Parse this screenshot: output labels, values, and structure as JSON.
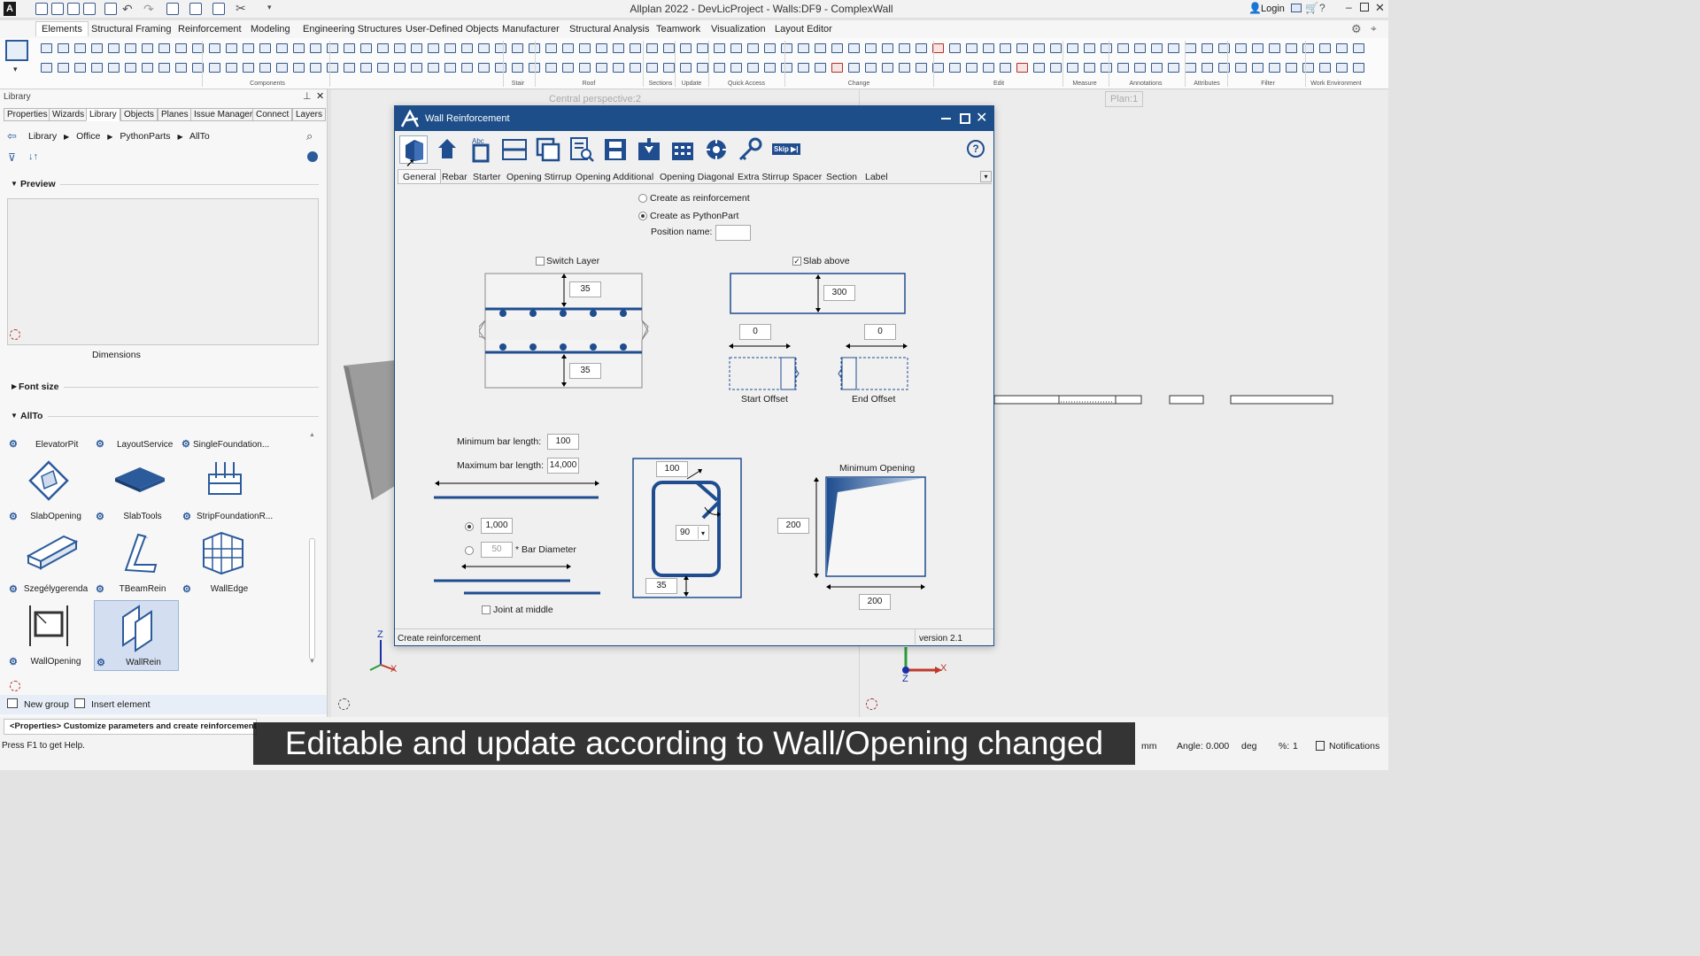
{
  "window": {
    "title": "Allplan 2022 - DevLicProject - Walls:DF9 - ComplexWall",
    "login_label": "Login"
  },
  "ribbon": {
    "tabs": [
      "Elements",
      "Structural Framing",
      "Reinforcement",
      "Modeling",
      "Engineering Structures",
      "User-Defined Objects",
      "Manufacturer",
      "Structural Analysis",
      "Teamwork",
      "Visualization",
      "Layout Editor"
    ],
    "active_tab": "Elements",
    "groups": [
      "Components",
      "Stair",
      "Roof",
      "Sections",
      "Update",
      "Quick Access",
      "Change",
      "Edit",
      "Measure",
      "Annotations",
      "Attributes",
      "Filter",
      "Work Environment"
    ]
  },
  "library": {
    "title": "Library",
    "tabs": [
      "Properties",
      "Wizards",
      "Library",
      "Objects",
      "Planes",
      "Issue Manager",
      "Connect",
      "Layers"
    ],
    "active_tab": "Library",
    "breadcrumb": [
      "Library",
      "Office",
      "PythonParts",
      "AllTo"
    ],
    "preview_label": "Preview",
    "dimensions_label": "Dimensions",
    "font_size_label": "Font size",
    "group_label": "AllTo",
    "items_row1": [
      "ElevatorPit",
      "LayoutService",
      "SingleFoundation..."
    ],
    "items": [
      {
        "label": "SlabOpening",
        "icon": "slab-opening-icon"
      },
      {
        "label": "SlabTools",
        "icon": "slab-tools-icon"
      },
      {
        "label": "StripFoundationR...",
        "icon": "strip-foundation-icon"
      },
      {
        "label": "Szegélygerenda",
        "icon": "edge-beam-icon"
      },
      {
        "label": "TBeamRein",
        "icon": "tbeam-icon"
      },
      {
        "label": "WallEdge",
        "icon": "wall-edge-icon"
      },
      {
        "label": "WallOpening",
        "icon": "wall-opening-icon"
      },
      {
        "label": "WallRein",
        "icon": "wall-rein-icon"
      }
    ],
    "selected_item": "WallRein",
    "new_group_label": "New group",
    "insert_element_label": "Insert element",
    "properties_hint": "<Properties> Customize parameters and create reinforcement"
  },
  "viewport": {
    "left_view_label": "Central perspective:2",
    "right_view_label": "Plan:1",
    "axis_z": "Z",
    "axis_x": "X"
  },
  "dialog": {
    "title": "Wall Reinforcement",
    "skip_label": "Skip",
    "tabs": [
      "General",
      "Rebar",
      "Starter",
      "Opening Stirrup",
      "Opening Additional",
      "Opening Diagonal",
      "Extra Stirrup",
      "Spacer",
      "Section",
      "Label"
    ],
    "active_tab": "General",
    "create_as_reinforcement": "Create as reinforcement",
    "create_as_pythonpart": "Create as PythonPart",
    "position_name_label": "Position name:",
    "position_name_value": "",
    "switch_layer_label": "Switch Layer",
    "switch_layer_checked": false,
    "top_cover": "35",
    "bottom_cover": "35",
    "slab_above_label": "Slab above",
    "slab_above_checked": true,
    "slab_above_value": "300",
    "start_offset_value": "0",
    "end_offset_value": "0",
    "start_offset_label": "Start Offset",
    "end_offset_label": "End Offset",
    "min_bar_length_label": "Minimum bar length:",
    "min_bar_length_value": "100",
    "max_bar_length_label": "Maximum bar length:",
    "max_bar_length_value": "14,000",
    "overlap_value": "1,000",
    "bar_diameter_factor": "50",
    "bar_diameter_label": "* Bar Diameter",
    "joint_at_middle_label": "Joint at middle",
    "hook_length": "100",
    "hook_angle": "90",
    "stirrup_cover": "35",
    "min_opening_label": "Minimum Opening",
    "min_opening_height": "200",
    "min_opening_width": "200",
    "status_left": "Create reinforcement",
    "status_right": "version 2.1"
  },
  "statusbar": {
    "help_text": "Press F1 to get Help.",
    "unit": "mm",
    "angle_label": "Angle:",
    "angle_value": "0.000",
    "angle_unit": "deg",
    "percent_label": "%:",
    "percent_value": "1",
    "notifications_label": "Notifications"
  },
  "caption": "Editable and update according to Wall/Opening changed",
  "colors": {
    "accent": "#1d4e89",
    "rebar": "#1f4d8f",
    "icon_blue": "#2c5b9b"
  }
}
